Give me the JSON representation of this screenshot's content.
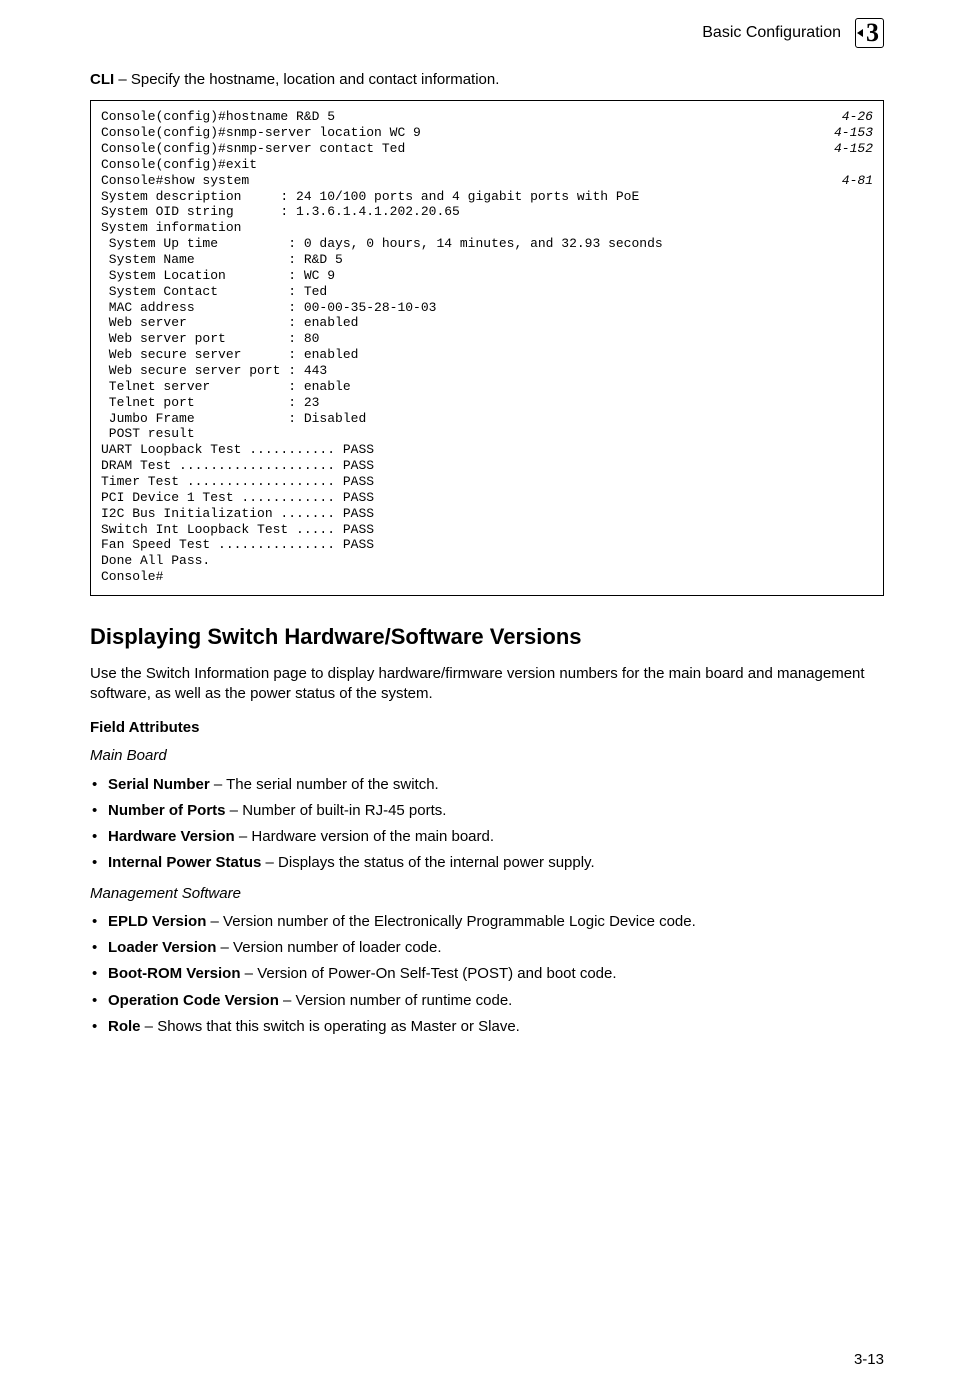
{
  "header": {
    "section_title": "Basic Configuration",
    "chapter_badge": "3"
  },
  "cli_intro": {
    "prefix": "CLI",
    "rest": " – Specify the hostname, location and contact information."
  },
  "codebox": {
    "rows": [
      {
        "left": "Console(config)#hostname R&D 5",
        "right": "4-26"
      },
      {
        "left": "Console(config)#snmp-server location WC 9",
        "right": "4-153"
      },
      {
        "left": "Console(config)#snmp-server contact Ted",
        "right": "4-152"
      },
      {
        "left": "Console(config)#exit",
        "right": ""
      },
      {
        "left": "Console#show system",
        "right": "4-81"
      },
      {
        "left": "System description     : 24 10/100 ports and 4 gigabit ports with PoE",
        "right": ""
      },
      {
        "left": "System OID string      : 1.3.6.1.4.1.202.20.65",
        "right": ""
      },
      {
        "left": "System information",
        "right": ""
      },
      {
        "left": " System Up time         : 0 days, 0 hours, 14 minutes, and 32.93 seconds",
        "right": ""
      },
      {
        "left": " System Name            : R&D 5",
        "right": ""
      },
      {
        "left": " System Location        : WC 9",
        "right": ""
      },
      {
        "left": " System Contact         : Ted",
        "right": ""
      },
      {
        "left": " MAC address            : 00-00-35-28-10-03",
        "right": ""
      },
      {
        "left": " Web server             : enabled",
        "right": ""
      },
      {
        "left": " Web server port        : 80",
        "right": ""
      },
      {
        "left": " Web secure server      : enabled",
        "right": ""
      },
      {
        "left": " Web secure server port : 443",
        "right": ""
      },
      {
        "left": " Telnet server          : enable",
        "right": ""
      },
      {
        "left": " Telnet port            : 23",
        "right": ""
      },
      {
        "left": " Jumbo Frame            : Disabled",
        "right": ""
      },
      {
        "left": " POST result",
        "right": ""
      },
      {
        "left": "UART Loopback Test ........... PASS",
        "right": ""
      },
      {
        "left": "DRAM Test .................... PASS",
        "right": ""
      },
      {
        "left": "Timer Test ................... PASS",
        "right": ""
      },
      {
        "left": "PCI Device 1 Test ............ PASS",
        "right": ""
      },
      {
        "left": "I2C Bus Initialization ....... PASS",
        "right": ""
      },
      {
        "left": "Switch Int Loopback Test ..... PASS",
        "right": ""
      },
      {
        "left": "Fan Speed Test ............... PASS",
        "right": ""
      },
      {
        "left": "",
        "right": ""
      },
      {
        "left": "Done All Pass.",
        "right": ""
      },
      {
        "left": "Console#",
        "right": ""
      }
    ]
  },
  "section": {
    "heading": "Displaying Switch Hardware/Software Versions",
    "intro": "Use the Switch Information page to display hardware/firmware version numbers for the main board and management software, as well as the power status of the system.",
    "field_attr_label": "Field Attributes",
    "main_board_label": "Main Board",
    "main_board_items": [
      {
        "term": "Serial Number",
        "desc": " – The serial number of the switch."
      },
      {
        "term": "Number of Ports",
        "desc": " – Number of built-in RJ-45 ports."
      },
      {
        "term": "Hardware Version",
        "desc": " – Hardware version of the main board."
      },
      {
        "term": "Internal Power Status",
        "desc": " – Displays the status of the internal power supply."
      }
    ],
    "mgmt_label": "Management Software",
    "mgmt_items": [
      {
        "term": "EPLD Version",
        "desc": " – Version number of the Electronically Programmable Logic Device code."
      },
      {
        "term": "Loader Version",
        "desc": " – Version number of loader code."
      },
      {
        "term": "Boot-ROM Version",
        "desc": " – Version of Power-On Self-Test (POST) and boot code."
      },
      {
        "term": "Operation Code Version",
        "desc": " – Version number of runtime code."
      },
      {
        "term": "Role",
        "desc": " – Shows that this switch is operating as Master or Slave."
      }
    ]
  },
  "page_number": "3-13"
}
